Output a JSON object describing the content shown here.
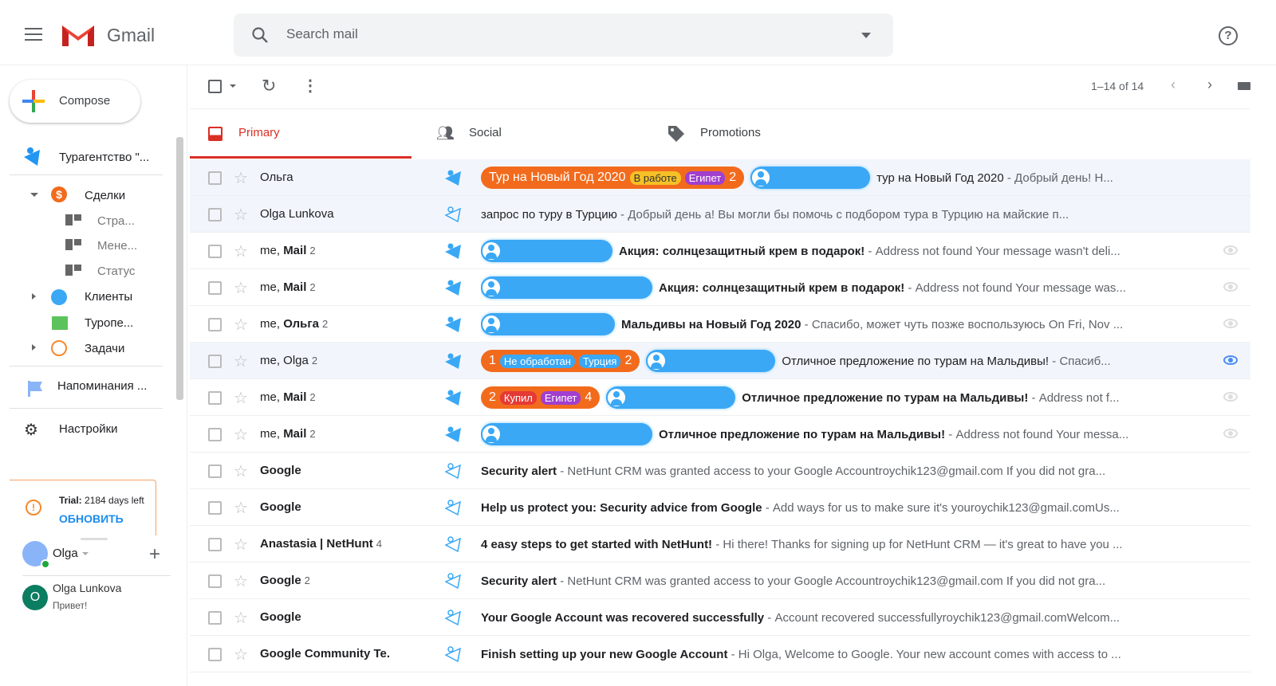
{
  "header": {
    "app_name": "Gmail",
    "search_placeholder": "Search mail",
    "help_icon": "?"
  },
  "sidebar": {
    "compose": "Compose",
    "crm_title": "Турагентство \"...",
    "deals": "Сделки",
    "deal_views": [
      "Стра...",
      "Мене...",
      "Статус"
    ],
    "clients": "Клиенты",
    "touroperators": "Туропе...",
    "tasks": "Задачи",
    "reminders": "Напоминания ...",
    "settings": "Настройки",
    "trial_label": "Trial:",
    "trial_text": "2184 days left",
    "upgrade": "ОБНОВИТЬ",
    "account_name": "Olga",
    "hangouts": [
      {
        "initial": "O",
        "name": "Olga Lunkova",
        "status": "Привет!"
      }
    ]
  },
  "toolbar": {
    "pagination": "1–14 of 14"
  },
  "tabs": [
    {
      "label": "Primary",
      "active": true
    },
    {
      "label": "Social"
    },
    {
      "label": "Promotions"
    }
  ],
  "colors": {
    "accent": "#d93025",
    "deal": "#f26b1d",
    "contact": "#3aa8f5"
  },
  "emails": [
    {
      "sender": "Ольга",
      "bold": "",
      "count": "",
      "read": true,
      "deal": {
        "text": "Тур на Новый Год 2020",
        "tags": [
          {
            "t": "В работе",
            "c": "#f6c026",
            "fc": "#333"
          },
          {
            "t": "Египет",
            "c": "#a13fcf",
            "fc": "#fff"
          }
        ],
        "num": "2"
      },
      "chip": 150,
      "subject": "тур на Новый Год 2020",
      "sb": false,
      "snippet": "Добрый день! Н...",
      "eye": ""
    },
    {
      "sender": "Olga Lunkova",
      "bold": "",
      "count": "",
      "read": true,
      "subject": "запрос по туру в Турцию",
      "sb": false,
      "snippet": "Добрый день   а! Вы могли бы помочь с подбором тура в Турцию на майские п...",
      "eye": ""
    },
    {
      "sender": "me, ",
      "bold": "Mail",
      "count": "2",
      "chip": 165,
      "subject": "Акция: солнцезащитный крем в подарок!",
      "sb": true,
      "snippet": "Address not found Your message wasn't deli...",
      "eye": "off"
    },
    {
      "sender": "me, ",
      "bold": "Mail",
      "count": "2",
      "chip": 215,
      "subject": "Акция: солнцезащитный крем в подарок!",
      "sb": true,
      "snippet": "Address not found Your message was...",
      "eye": "off"
    },
    {
      "sender": "me, ",
      "bold": "Ольга",
      "count": "2",
      "chip": 168,
      "subject": "Мальдивы на Новый Год 2020",
      "sb": true,
      "snippet": "Спасибо, может чуть позже воспользуюсь On Fri, Nov ...",
      "eye": "off"
    },
    {
      "sender": "me, Olga",
      "bold": "",
      "count": "2",
      "read": true,
      "deal": {
        "text": "1",
        "tags": [
          {
            "t": "Не обработан",
            "c": "#3aa8f5",
            "fc": "#fff"
          },
          {
            "t": "Турция",
            "c": "#3aa8f5",
            "fc": "#fff"
          }
        ],
        "num": "2"
      },
      "chip": 162,
      "subject": "Отличное предложение по турам на Мальдивы!",
      "sb": false,
      "snippet": "Спасиб...",
      "eye": "on"
    },
    {
      "sender": "me, ",
      "bold": "Mail",
      "count": "2",
      "deal": {
        "text": "2",
        "tags": [
          {
            "t": "Купил",
            "c": "#e53935",
            "fc": "#fff"
          },
          {
            "t": "Египет",
            "c": "#a13fcf",
            "fc": "#fff"
          }
        ],
        "num": "4"
      },
      "chip": 162,
      "subject": "Отличное предложение по турам на Мальдивы!",
      "sb": true,
      "snippet": "Address not f...",
      "eye": "off"
    },
    {
      "sender": "me, ",
      "bold": "Mail",
      "count": "2",
      "chip": 215,
      "subject": "Отличное предложение по турам на Мальдивы!",
      "sb": true,
      "snippet": "Address not found Your messa...",
      "eye": "off"
    },
    {
      "sender": "",
      "bold": "Google",
      "count": "",
      "subject": "Security alert",
      "sb": true,
      "snippet": "NetHunt CRM was granted access to your Google Accountroychik123@gmail.com If you did not gra...",
      "eye": ""
    },
    {
      "sender": "",
      "bold": "Google",
      "count": "",
      "subject": "Help us protect you: Security advice from Google",
      "sb": true,
      "snippet": "Add ways for us to make sure it's youroychik123@gmail.comUs...",
      "eye": ""
    },
    {
      "sender": "",
      "bold": "Anastasia | NetHunt",
      "count": "4",
      "subject": "4 easy steps to get started with NetHunt!",
      "sb": true,
      "snippet": "Hi there! Thanks for signing up for NetHunt CRM — it's great to have you ...",
      "eye": ""
    },
    {
      "sender": "",
      "bold": "Google",
      "count": "2",
      "subject": "Security alert",
      "sb": true,
      "snippet": "NetHunt CRM was granted access to your Google Accountroychik123@gmail.com If you did not gra...",
      "eye": ""
    },
    {
      "sender": "",
      "bold": "Google",
      "count": "",
      "subject": "Your Google Account was recovered successfully",
      "sb": true,
      "snippet": "Account recovered successfullyroychik123@gmail.comWelcom...",
      "eye": ""
    },
    {
      "sender": "",
      "bold": "Google Community Te.",
      "count": "",
      "subject": "Finish setting up your new Google Account",
      "sb": true,
      "snippet": "Hi Olga, Welcome to Google. Your new account comes with access to ...",
      "eye": ""
    }
  ]
}
